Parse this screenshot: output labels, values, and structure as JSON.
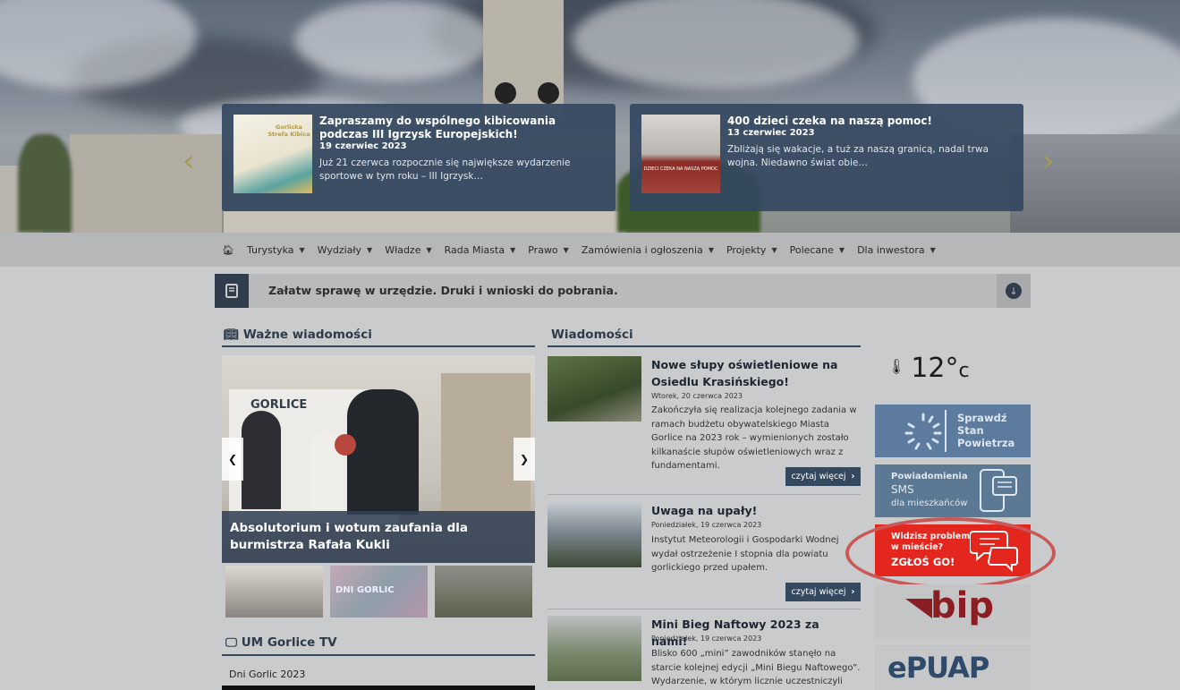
{
  "hero": {
    "slides": [
      {
        "title": "Zapraszamy do wspólnego kibicowania podczas III Igrzysk Europejskich!",
        "date": "19 czerwiec 2023",
        "text": "Już 21 czerwca rozpocznie się największe wydarzenie sportowe w tym roku – III Igrzysk…",
        "thumb_text": "Gorlicka Strefa Kibica"
      },
      {
        "title": "400 dzieci czeka na naszą pomoc!",
        "date": "13 czerwiec 2023",
        "text": "Zbliżają się wakacje, a tuż za naszą granicą, nadal trwa wojna. Niedawno świat obie…",
        "thumb_text": "DZIECI CZEKA NA NASZĄ POMOC"
      }
    ]
  },
  "nav": {
    "home_icon": "home-icon",
    "items": [
      "Turystyka",
      "Wydziały",
      "Władze",
      "Rada Miasta",
      "Prawo",
      "Zamówienia i ogłoszenia",
      "Projekty",
      "Polecane",
      "Dla inwestora"
    ]
  },
  "download_bar": {
    "text": "Załatw sprawę w urzędzie. Druki i wnioski do pobrania."
  },
  "important": {
    "heading": "Ważne wiadomości",
    "slide_title": "Absolutorium i wotum zaufania dla burmistrza Rafała Kukli",
    "banner_text": "GORLICE",
    "thumb_text": "DNI GORLIC"
  },
  "tv": {
    "heading": "UM Gorlice TV",
    "video_title": "Dni Gorlic 2023"
  },
  "news": {
    "heading": "Wiadomości",
    "more_label": "czytaj więcej",
    "items": [
      {
        "title": "Nowe słupy oświetleniowe na Osiedlu Krasińskiego!",
        "date": "Wtorek, 20 czerwca 2023",
        "text": "Zakończyła się realizacja kolejnego zadania w ramach budżetu obywatelskiego Miasta Gorlice na 2023 rok – wymienionych zostało kilkanaście słupów oświetleniowych wraz z fundamentami."
      },
      {
        "title": "Uwaga na upały!",
        "date": "Poniedziałek, 19 czerwca 2023",
        "text": "Instytut Meteorologii i Gospodarki Wodnej wydał ostrzeżenie I stopnia dla powiatu gorlickiego przed upałem."
      },
      {
        "title": "Mini Bieg Naftowy 2023 za nami!",
        "date": "Poniedziałek, 19 czerwca 2023",
        "text": "Blisko 600 „mini” zawodników stanęło na starcie kolejnej edycji „Mini Biegu Naftowego”. Wydarzenie, w którym licznie uczestniczyli"
      }
    ]
  },
  "sidebar": {
    "temperature": "12°",
    "temperature_unit": "c",
    "air": "Sprawdź Stan Powietrza",
    "sms_line1": "Powiadomienia",
    "sms_line2": "SMS",
    "sms_line3": "dla mieszkańców",
    "report_line1": "Widzisz problem",
    "report_line2": "w mieście?",
    "report_line3": "ZGŁOŚ GO!",
    "bip": "bip",
    "epuap": "ePUAP"
  },
  "colors": {
    "dark_navy": "#34495e",
    "report_red": "#e3271e",
    "air_blue": "#5d7b9e"
  }
}
